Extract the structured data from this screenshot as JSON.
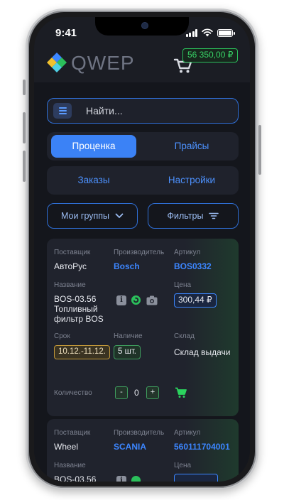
{
  "status": {
    "time": "9:41"
  },
  "header": {
    "brand": "QWEP",
    "balance": "56 350,00 ₽"
  },
  "search": {
    "placeholder": "Найти..."
  },
  "tabs": {
    "row1": [
      {
        "label": "Проценка",
        "active": true
      },
      {
        "label": "Прайсы",
        "active": false
      }
    ],
    "row2": [
      {
        "label": "Заказы",
        "active": false
      },
      {
        "label": "Настройки",
        "active": false
      }
    ]
  },
  "filters": {
    "groups_label": "Мои группы",
    "filters_label": "Фильтры"
  },
  "labels": {
    "supplier": "Поставщик",
    "brand": "Производитель",
    "article": "Артикул",
    "name": "Название",
    "price": "Цена",
    "term": "Срок",
    "stock": "Наличие",
    "warehouse": "Склад",
    "quantity": "Количество"
  },
  "results": [
    {
      "supplier": "АвтоРус",
      "brand": "Bosch",
      "article": "BOS0332",
      "name": "BOS-03.56 Топливный фильтр BOS",
      "price": "300,44 ₽",
      "term": "10.12.-11.12.",
      "stock": "5 шт.",
      "warehouse": "Склад выдачи",
      "quantity": "0",
      "info_icon_glyph": "i"
    },
    {
      "supplier": "Wheel",
      "brand": "SCANIA",
      "article": "560111704001",
      "name": "BOS-03.56",
      "info_icon_glyph": "i"
    }
  ],
  "qty_controls": {
    "minus": "-",
    "plus": "+"
  },
  "colors": {
    "accent_blue": "#3b82f6",
    "link_blue": "#3c86ff",
    "success_green": "#37d266",
    "warning_amber": "#c59a3a",
    "background": "#14161c"
  }
}
